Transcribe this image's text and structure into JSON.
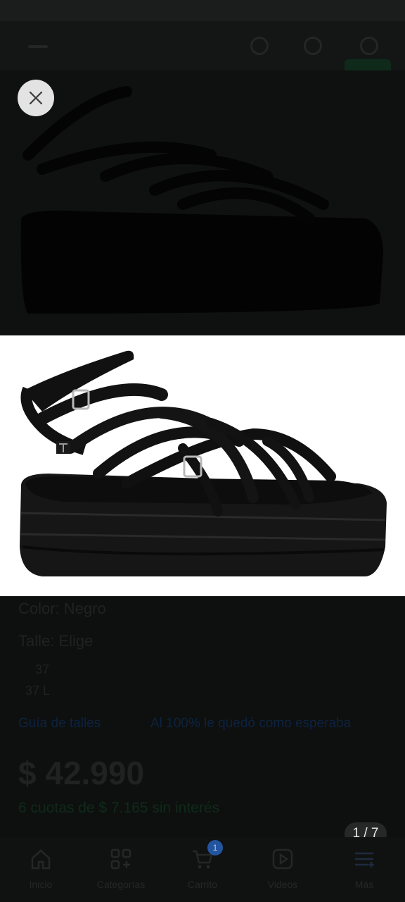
{
  "viewer": {
    "counter": "1 / 7",
    "close_icon": "close-icon"
  },
  "product": {
    "color_label": "Color: Negro",
    "size_label": "Talle: Elige",
    "size_options": [
      "37",
      "37 L"
    ],
    "size_guide_link": "Guía de talles",
    "fit_hint": "Al 100% le quedó como esperaba",
    "price": "$ 42.990",
    "installments": "6 cuotas de $ 7.165 sin interés"
  },
  "bottom_nav": {
    "items": [
      {
        "label": "Inicio",
        "icon": "home-icon"
      },
      {
        "label": "Categorías",
        "icon": "categories-icon"
      },
      {
        "label": "Carrito",
        "icon": "cart-icon",
        "badge": "1"
      },
      {
        "label": "Videos",
        "icon": "video-icon"
      },
      {
        "label": "Más",
        "icon": "menu-icon"
      }
    ]
  },
  "colors": {
    "overlay": "#0e100f",
    "close_button": "#e3e3e3",
    "counter_bg": "#262827",
    "link_dim": "#0d2240"
  }
}
